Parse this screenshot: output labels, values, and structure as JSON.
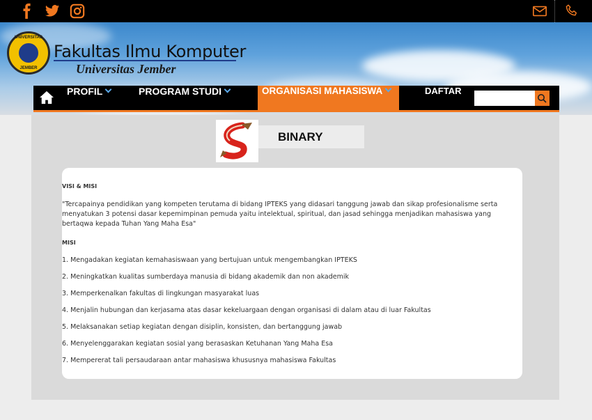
{
  "social": {
    "facebook": "facebook-icon",
    "twitter": "twitter-icon",
    "instagram": "instagram-icon",
    "mail": "mail-icon",
    "phone": "phone-icon"
  },
  "header": {
    "title": "Fakultas Ilmu Komputer",
    "subtitle": "Universitas Jember",
    "logo_top": "UNIVERSITAS",
    "logo_bottom": "JEMBER"
  },
  "nav": {
    "items": [
      {
        "label": "PROFIL"
      },
      {
        "label": "PROGRAM STUDI"
      },
      {
        "label": "ORGANISASI MAHASISWA"
      },
      {
        "label": "DAFTAR"
      }
    ],
    "search_placeholder": ""
  },
  "org": {
    "name": "BINARY"
  },
  "card": {
    "visi_heading": "VISI & MISI",
    "visi_text": "\"Tercapainya pendidikan yang kompeten terutama di bidang IPTEKS yang didasari tanggung jawab dan sikap profesionalisme serta menyatukan 3 potensi dasar kepemimpinan pemuda yaitu intelektual, spiritual, dan jasad sehingga menjadikan mahasiswa yang bertaqwa kepada Tuhan Yang Maha Esa\"",
    "misi_heading": "MISI",
    "misi": [
      "1. Mengadakan kegiatan kemahasiswaan yang bertujuan untuk mengembangkan IPTEKS",
      "2. Meningkatkan kualitas sumberdaya manusia di bidang akademik dan non akademik",
      "3. Memperkenalkan fakultas di lingkungan masyarakat luas",
      "4. Menjalin hubungan dan kerjasama atas dasar kekeluargaan dengan organisasi di dalam atau di luar Fakultas",
      "5. Melaksanakan setiap kegiatan dengan disiplin, konsisten, dan bertanggung jawab",
      "6. Menyelenggarakan kegiatan sosial yang berasaskan Ketuhanan Yang Maha Esa",
      "7. Mempererat tali persaudaraan antar mahasiswa khususnya mahasiswa Fakultas"
    ]
  },
  "colors": {
    "accent": "#f07820",
    "nav_bg": "#000000",
    "chevron": "#5aa8e8"
  }
}
